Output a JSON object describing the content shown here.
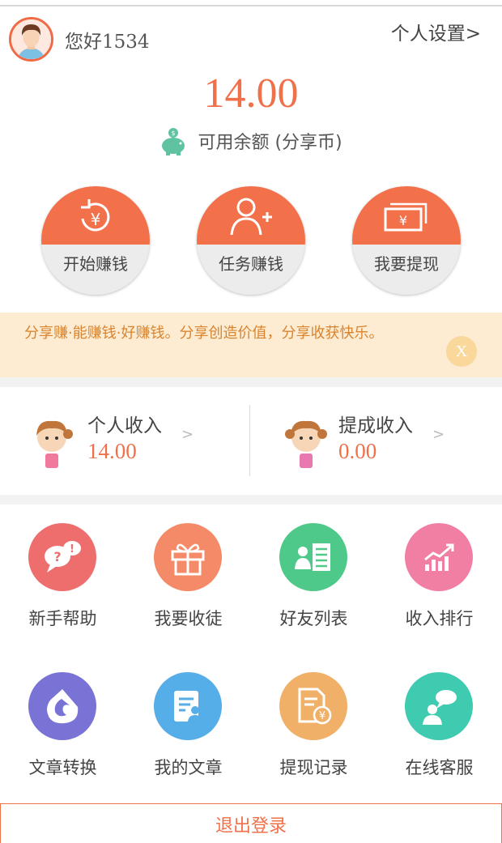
{
  "header": {
    "greeting": "您好1534",
    "settings_label": "个人设置>",
    "avatar_icon": "user-avatar-icon"
  },
  "balance": {
    "amount": "14.00",
    "label": "可用余额 (分享币)",
    "icon": "piggy-bank-icon"
  },
  "actions": [
    {
      "label": "开始赚钱",
      "icon": "yen-refresh-icon"
    },
    {
      "label": "任务赚钱",
      "icon": "add-user-icon"
    },
    {
      "label": "我要提现",
      "icon": "banknote-icon"
    }
  ],
  "notice": {
    "text": "分享赚·能赚钱·好赚钱。分享创造价值，分享收获快乐。",
    "close_label": "X"
  },
  "income": {
    "personal": {
      "title": "个人收入",
      "value": "14.00",
      "arrow": ">"
    },
    "commission": {
      "title": "提成收入",
      "value": "0.00",
      "arrow": ">"
    }
  },
  "grid": [
    {
      "label": "新手帮助",
      "icon": "help-chat-icon",
      "color": "#ee6d6d"
    },
    {
      "label": "我要收徒",
      "icon": "gift-icon",
      "color": "#f58a68"
    },
    {
      "label": "好友列表",
      "icon": "contact-list-icon",
      "color": "#4fc98a"
    },
    {
      "label": "收入排行",
      "icon": "trend-chart-icon",
      "color": "#f07fa3"
    },
    {
      "label": "文章转换",
      "icon": "convert-icon",
      "color": "#7a73d6"
    },
    {
      "label": "我的文章",
      "icon": "document-user-icon",
      "color": "#56aee8"
    },
    {
      "label": "提现记录",
      "icon": "withdraw-record-icon",
      "color": "#f0b068"
    },
    {
      "label": "在线客服",
      "icon": "customer-service-icon",
      "color": "#3ecbb0"
    }
  ],
  "logout_label": "退出登录",
  "colors": {
    "accent": "#f0704a",
    "notice_bg": "#fdebd2",
    "notice_text": "#d9842d"
  }
}
